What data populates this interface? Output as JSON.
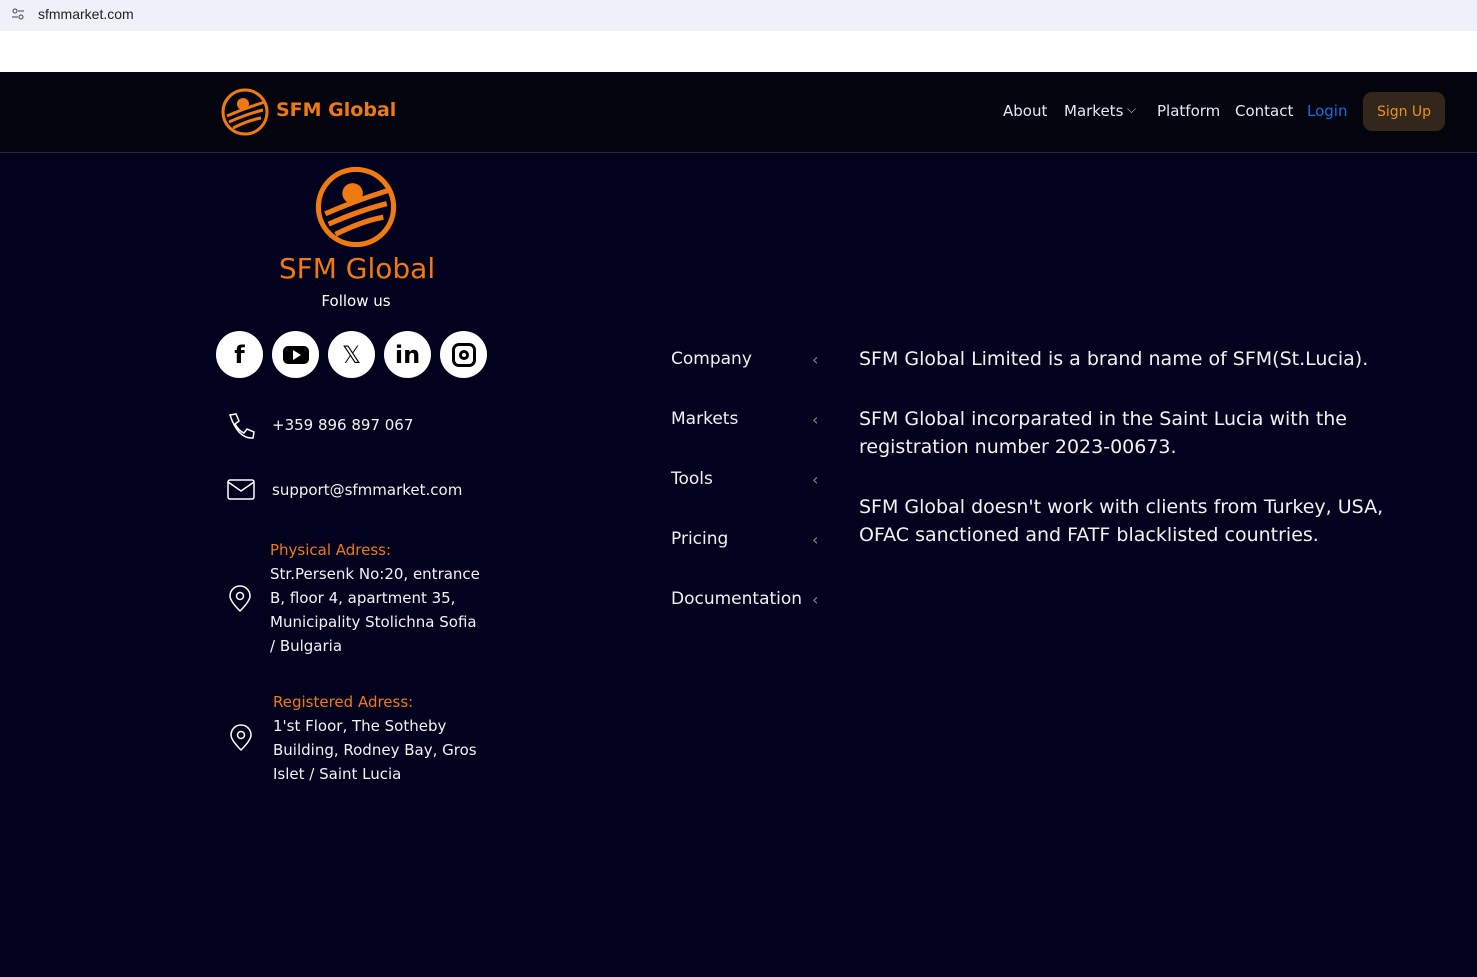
{
  "browser": {
    "url": "sfmmarket.com"
  },
  "header": {
    "brand": "SFM Global",
    "nav": [
      "About",
      "Markets",
      "Platform",
      "Contact",
      "Login"
    ],
    "signup": "Sign Up",
    "colors": {
      "accent": "#f07a12",
      "login": "#1a6be0"
    }
  },
  "footer": {
    "brand": "SFM Global",
    "follow": "Follow us",
    "social": [
      "facebook-icon",
      "youtube-icon",
      "x-icon",
      "linkedin-icon",
      "instagram-icon"
    ],
    "phone": "+359 896 897 067",
    "email": "support@sfmmarket.com",
    "physical_label": "Physical Adress:",
    "physical": "Str.Persenk No:20, entrance B, floor 4, apartment 35, Municipality Stolichna Sofia / Bulgaria",
    "registered_label": "Registered Adress:",
    "registered": "1'st Floor, The Sotheby Building, Rodney Bay, Gros Islet / Saint Lucia",
    "menu": [
      "Company",
      "Markets",
      "Tools",
      "Pricing",
      "Documentation"
    ],
    "info": [
      "SFM Global Limited is a brand name of SFM(St.Lucia).",
      "SFM Global incorparated in the Saint Lucia with the registration number 2023-00673.",
      "SFM Global doesn't work with clients from Turkey, USA, OFAC sanctioned and FATF blacklisted countries."
    ]
  }
}
